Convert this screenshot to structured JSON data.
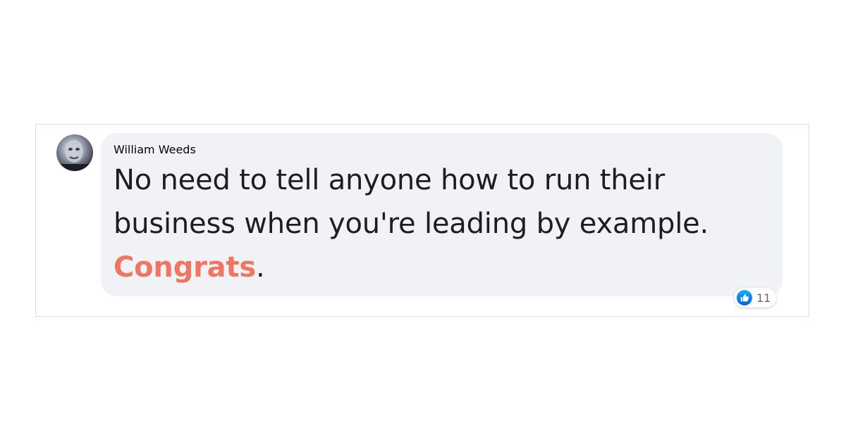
{
  "comment": {
    "author": "William Weeds",
    "text_line1": "No need to tell anyone how to run their",
    "text_line2": "business when you're leading by example.",
    "highlight": "Congrats",
    "trailing": ".",
    "highlight_color": "#f07562",
    "bubble_color": "#f0f2f5"
  },
  "reactions": {
    "icon": "like-icon",
    "count": "11",
    "icon_color": "#1877f2"
  }
}
